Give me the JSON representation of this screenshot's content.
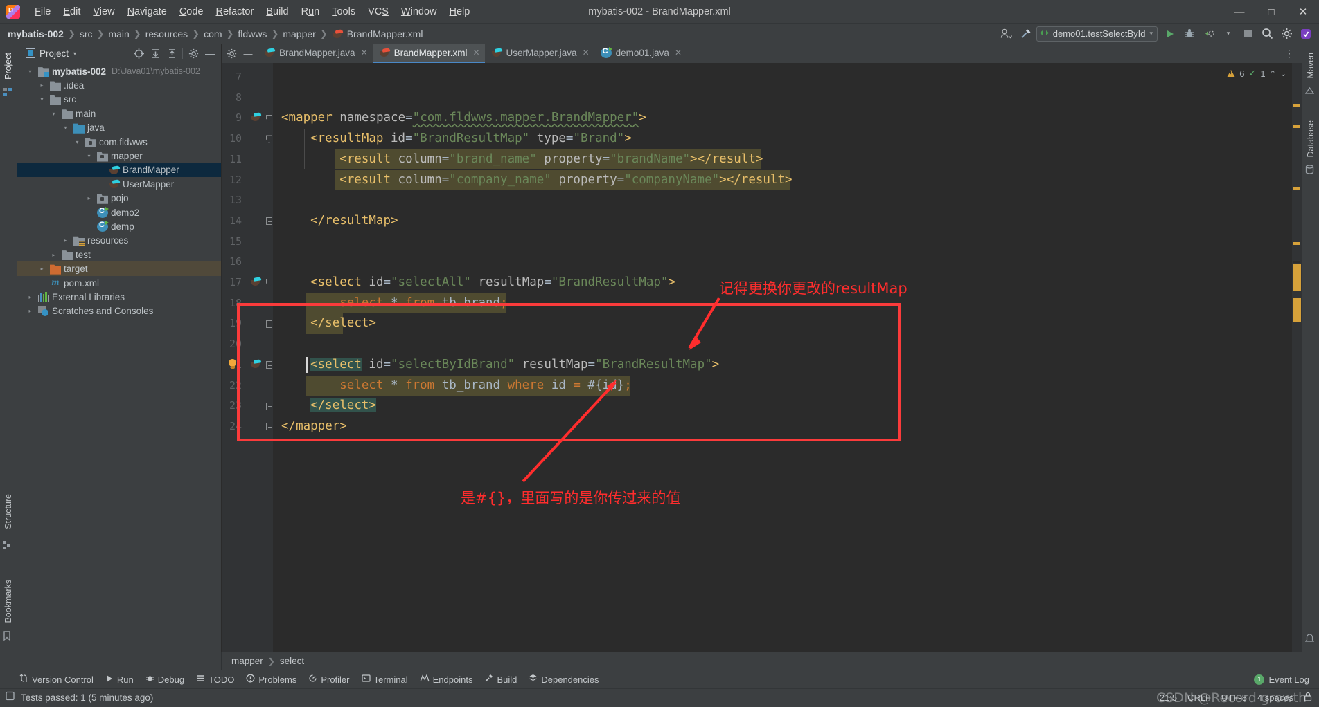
{
  "window": {
    "title": "mybatis-002 - BrandMapper.xml",
    "logo_icon": "intellij-idea-logo",
    "minimize_icon": "minimize-icon",
    "maximize_icon": "maximize-icon",
    "close_icon": "close-icon"
  },
  "menu": [
    "File",
    "Edit",
    "View",
    "Navigate",
    "Code",
    "Refactor",
    "Build",
    "Run",
    "Tools",
    "VCS",
    "Window",
    "Help"
  ],
  "breadcrumb": {
    "items": [
      "mybatis-002",
      "src",
      "main",
      "resources",
      "com",
      "fldwws",
      "mapper",
      "BrandMapper.xml"
    ],
    "separator": "❯"
  },
  "navbar_right": {
    "run_config": "demo01.testSelectById",
    "dropdown_caret": "▾",
    "icons": [
      "user-settings-icon",
      "build-hammer-icon",
      "run-icon",
      "debug-icon",
      "run-coverage-icon",
      "more-run-icon",
      "stop-icon",
      "search-everywhere-icon",
      "settings-gear-icon",
      "updates-icon"
    ]
  },
  "left_strip": {
    "tabs": [
      "Project",
      "Structure",
      "Bookmarks"
    ],
    "active": "Project"
  },
  "right_strip": {
    "tabs": [
      "Maven",
      "Database"
    ]
  },
  "project_panel": {
    "header_title": "Project",
    "header_caret": "▾",
    "icons": [
      "select-opened-file-icon",
      "expand-all-icon",
      "collapse-all-icon",
      "settings-gear-icon",
      "hide-icon"
    ],
    "tree": [
      {
        "label": "mybatis-002",
        "path": "D:\\Java01\\mybatis-002",
        "depth": 0,
        "arrow": "open",
        "icon": "module-folder-icon",
        "bold": true
      },
      {
        "label": ".idea",
        "path": "",
        "depth": 1,
        "arrow": "closed",
        "icon": "folder-icon"
      },
      {
        "label": "src",
        "path": "",
        "depth": 1,
        "arrow": "open",
        "icon": "folder-icon"
      },
      {
        "label": "main",
        "path": "",
        "depth": 2,
        "arrow": "open",
        "icon": "folder-icon"
      },
      {
        "label": "java",
        "path": "",
        "depth": 3,
        "arrow": "open",
        "icon": "source-folder-icon"
      },
      {
        "label": "com.fldwws",
        "path": "",
        "depth": 4,
        "arrow": "open",
        "icon": "package-icon"
      },
      {
        "label": "mapper",
        "path": "",
        "depth": 5,
        "arrow": "open",
        "icon": "package-icon"
      },
      {
        "label": "BrandMapper",
        "path": "",
        "depth": 6,
        "arrow": "none",
        "icon": "mybatis-mapper-icon",
        "selected": true
      },
      {
        "label": "UserMapper",
        "path": "",
        "depth": 6,
        "arrow": "none",
        "icon": "mybatis-mapper-icon"
      },
      {
        "label": "pojo",
        "path": "",
        "depth": 5,
        "arrow": "closed",
        "icon": "package-icon"
      },
      {
        "label": "demo2",
        "path": "",
        "depth": 5,
        "arrow": "none",
        "icon": "java-class-icon"
      },
      {
        "label": "demp",
        "path": "",
        "depth": 5,
        "arrow": "none",
        "icon": "java-class-icon"
      },
      {
        "label": "resources",
        "path": "",
        "depth": 3,
        "arrow": "closed",
        "icon": "resources-folder-icon"
      },
      {
        "label": "test",
        "path": "",
        "depth": 2,
        "arrow": "closed",
        "icon": "folder-icon"
      },
      {
        "label": "target",
        "path": "",
        "depth": 1,
        "arrow": "closed",
        "icon": "excluded-folder-icon",
        "highlight": true
      },
      {
        "label": "pom.xml",
        "path": "",
        "depth": 1,
        "arrow": "none",
        "icon": "maven-pom-icon"
      },
      {
        "label": "External Libraries",
        "path": "",
        "depth": 0,
        "arrow": "closed",
        "icon": "libraries-icon"
      },
      {
        "label": "Scratches and Consoles",
        "path": "",
        "depth": 0,
        "arrow": "closed",
        "icon": "scratches-icon"
      }
    ]
  },
  "editor": {
    "gear_icons": [
      "settings-gear-icon",
      "hide-icon"
    ],
    "tabs": [
      {
        "label": "BrandMapper.java",
        "icon": "mybatis-mapper-icon",
        "active": false,
        "close": "✕"
      },
      {
        "label": "BrandMapper.xml",
        "icon": "mybatis-xml-icon",
        "active": true,
        "close": "✕"
      },
      {
        "label": "UserMapper.java",
        "icon": "mybatis-mapper-icon",
        "active": false,
        "close": "✕"
      },
      {
        "label": "demo01.java",
        "icon": "java-class-icon",
        "active": false,
        "close": "✕"
      }
    ],
    "kebab": "⋮",
    "inspections": {
      "warning_count": "6",
      "checked_count": "1",
      "warning_icon": "warning-triangle-icon",
      "ok_icon": "inspection-ok-icon",
      "caret_up": "⌃",
      "caret_down": "⌄"
    },
    "line_numbers": [
      "7",
      "8",
      "9",
      "10",
      "11",
      "12",
      "13",
      "14",
      "15",
      "16",
      "17",
      "18",
      "19",
      "20",
      "21",
      "22",
      "23",
      "24"
    ],
    "code_lines": [
      {
        "n": "7",
        "segments": []
      },
      {
        "n": "8",
        "segments": []
      },
      {
        "n": "9",
        "gutter_icon": "mybatis-mapper-icon",
        "fold": "open",
        "segments": [
          {
            "t": "<mapper ",
            "c": "kw"
          },
          {
            "t": "namespace",
            "c": "at"
          },
          {
            "t": "=",
            "c": "eq"
          },
          {
            "t": "\"com.fldwws.mapper.BrandMapper\"",
            "c": "st squig"
          },
          {
            "t": ">",
            "c": "kw"
          }
        ]
      },
      {
        "n": "10",
        "fold": "open",
        "indent": 4,
        "segments": [
          {
            "t": "<resultMap ",
            "c": "kw"
          },
          {
            "t": "id",
            "c": "at"
          },
          {
            "t": "=",
            "c": "eq"
          },
          {
            "t": "\"BrandResultMap\"",
            "c": "st"
          },
          {
            "t": " ",
            "c": "eq"
          },
          {
            "t": "type",
            "c": "at"
          },
          {
            "t": "=",
            "c": "eq"
          },
          {
            "t": "\"Brand\"",
            "c": "st"
          },
          {
            "t": ">",
            "c": "kw"
          }
        ]
      },
      {
        "n": "11",
        "indent": 8,
        "sqlbg": true,
        "segments": [
          {
            "t": "<result ",
            "c": "kw"
          },
          {
            "t": "column",
            "c": "at"
          },
          {
            "t": "=",
            "c": "eq"
          },
          {
            "t": "\"brand_name\"",
            "c": "st"
          },
          {
            "t": " ",
            "c": "eq"
          },
          {
            "t": "property",
            "c": "at"
          },
          {
            "t": "=",
            "c": "eq"
          },
          {
            "t": "\"brandName\"",
            "c": "st"
          },
          {
            "t": "></result>",
            "c": "kw"
          }
        ]
      },
      {
        "n": "12",
        "indent": 8,
        "sqlbg": true,
        "segments": [
          {
            "t": "<result ",
            "c": "kw"
          },
          {
            "t": "column",
            "c": "at"
          },
          {
            "t": "=",
            "c": "eq"
          },
          {
            "t": "\"company_name\"",
            "c": "st"
          },
          {
            "t": " ",
            "c": "eq"
          },
          {
            "t": "property",
            "c": "at"
          },
          {
            "t": "=",
            "c": "eq"
          },
          {
            "t": "\"companyName\"",
            "c": "st"
          },
          {
            "t": "></result>",
            "c": "kw"
          }
        ]
      },
      {
        "n": "13",
        "segments": []
      },
      {
        "n": "14",
        "fold": "closed",
        "indent": 4,
        "segments": [
          {
            "t": "</resultMap>",
            "c": "kw"
          }
        ]
      },
      {
        "n": "15",
        "segments": []
      },
      {
        "n": "16",
        "segments": []
      },
      {
        "n": "17",
        "gutter_icon": "mybatis-mapper-icon",
        "fold": "open",
        "indent": 4,
        "segments": [
          {
            "t": "<select ",
            "c": "kw"
          },
          {
            "t": "id",
            "c": "at"
          },
          {
            "t": "=",
            "c": "eq"
          },
          {
            "t": "\"selectAll\"",
            "c": "st"
          },
          {
            "t": " ",
            "c": "eq"
          },
          {
            "t": "resultMap",
            "c": "at"
          },
          {
            "t": "=",
            "c": "eq"
          },
          {
            "t": "\"BrandResultMap\"",
            "c": "st"
          },
          {
            "t": ">",
            "c": "kw"
          }
        ]
      },
      {
        "n": "18",
        "indent": 8,
        "sqlbg": true,
        "sqlbg_full": true,
        "segments": [
          {
            "t": "select ",
            "c": "sql"
          },
          {
            "t": "* ",
            "c": "eq"
          },
          {
            "t": "from ",
            "c": "sql"
          },
          {
            "t": "tb",
            "c": "sqlid"
          },
          {
            "t": " ",
            "c": "eq"
          },
          {
            "t": "brand",
            "c": "sqlid"
          },
          {
            "t": ";",
            "c": "sql"
          }
        ]
      },
      {
        "n": "19",
        "fold": "closed",
        "indent": 4,
        "sqlbg_pad": true,
        "segments": [
          {
            "t": "</select>",
            "c": "kw"
          }
        ]
      },
      {
        "n": "20",
        "segments": []
      },
      {
        "n": "21",
        "gutter_icon": "mybatis-mapper-icon",
        "fold": "closed",
        "bulb": true,
        "indent": 4,
        "caret": true,
        "segments": [
          {
            "t": "<select",
            "c": "kw hl2"
          },
          {
            "t": " ",
            "c": "eq"
          },
          {
            "t": "id",
            "c": "at"
          },
          {
            "t": "=",
            "c": "eq"
          },
          {
            "t": "\"selectByIdBrand\"",
            "c": "st"
          },
          {
            "t": " ",
            "c": "eq"
          },
          {
            "t": "resultMap",
            "c": "at"
          },
          {
            "t": "=",
            "c": "eq"
          },
          {
            "t": "\"BrandResultMap\"",
            "c": "st"
          },
          {
            "t": ">",
            "c": "kw"
          }
        ]
      },
      {
        "n": "22",
        "indent": 8,
        "sqlbg": true,
        "sqlbg_full": true,
        "segments": [
          {
            "t": "select ",
            "c": "sql"
          },
          {
            "t": "* ",
            "c": "eq"
          },
          {
            "t": "from ",
            "c": "sql"
          },
          {
            "t": "tb_brand ",
            "c": "sqlid"
          },
          {
            "t": "where ",
            "c": "sql"
          },
          {
            "t": "id ",
            "c": "sqlid"
          },
          {
            "t": "= ",
            "c": "sql"
          },
          {
            "t": "#{id}",
            "c": "eq"
          },
          {
            "t": ";",
            "c": "sql"
          }
        ]
      },
      {
        "n": "23",
        "fold": "closed",
        "indent": 4,
        "segments": [
          {
            "t": "</select>",
            "c": "kw hl2"
          }
        ]
      },
      {
        "n": "24",
        "fold": "closed",
        "indent": 0,
        "segments": [
          {
            "t": "</mapper>",
            "c": "kw"
          }
        ]
      }
    ]
  },
  "annotations": {
    "note_top": "记得更换你更改的resultMap",
    "note_bottom": "是#{}，里面写的是你传过来的值",
    "color": "#ff2d2d",
    "box_color": "#fb3b3b"
  },
  "bottom_breadcrumb": {
    "items": [
      "mapper",
      "select"
    ],
    "separator": "❯"
  },
  "tool_windows": [
    {
      "label": "Version Control",
      "icon": "version-control-icon"
    },
    {
      "label": "Run",
      "icon": "run-icon"
    },
    {
      "label": "Debug",
      "icon": "debug-icon"
    },
    {
      "label": "TODO",
      "icon": "todo-icon"
    },
    {
      "label": "Problems",
      "icon": "problems-icon"
    },
    {
      "label": "Profiler",
      "icon": "profiler-icon"
    },
    {
      "label": "Terminal",
      "icon": "terminal-icon"
    },
    {
      "label": "Endpoints",
      "icon": "endpoints-icon"
    },
    {
      "label": "Build",
      "icon": "build-hammer-icon"
    },
    {
      "label": "Dependencies",
      "icon": "dependencies-icon"
    }
  ],
  "event_log": {
    "label": "Event Log",
    "count": "1"
  },
  "status": {
    "text": "Tests passed: 1 (5 minutes ago)",
    "icon": "tests-passed-icon",
    "caret_position": "21:5",
    "line_separator": "CRLF",
    "encoding": "UTF-8",
    "indent": "4 spaces",
    "lock_icon": "read-only-lock-icon"
  },
  "watermark": "CSDN @Record growth"
}
